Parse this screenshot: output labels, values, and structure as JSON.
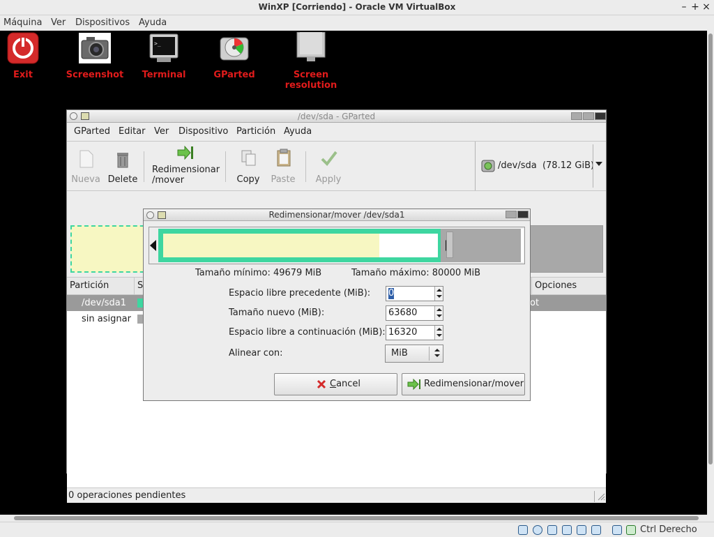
{
  "host": {
    "title": "WinXP [Corriendo] - Oracle VM VirtualBox",
    "controls": [
      "–",
      "+",
      "×"
    ],
    "menu": [
      "Máquina",
      "Ver",
      "Dispositivos",
      "Ayuda"
    ],
    "status_label": "Ctrl Derecho"
  },
  "desktop": {
    "icons": [
      {
        "label": "Exit",
        "icon": "power-icon"
      },
      {
        "label": "Screenshot",
        "icon": "camera-icon"
      },
      {
        "label": "Terminal",
        "icon": "terminal-icon"
      },
      {
        "label": "GParted",
        "icon": "gparted-icon"
      },
      {
        "label": "Screen resolution",
        "icon": "monitor-icon"
      }
    ],
    "label_color": "#e01b1b"
  },
  "gparted": {
    "title": "/dev/sda - GParted",
    "menu": [
      "GParted",
      "Editar",
      "Ver",
      "Dispositivo",
      "Partición",
      "Ayuda"
    ],
    "toolbar": {
      "new": "Nueva",
      "delete": "Delete",
      "resize_line1": "Redimensionar",
      "resize_line2": "/mover",
      "copy": "Copy",
      "paste": "Paste",
      "apply": "Apply"
    },
    "device": {
      "name": "/dev/sda",
      "size": "(78.12 GiB)"
    },
    "columns": {
      "partition": "Partición",
      "s": "S",
      "options": "Opciones"
    },
    "rows": [
      {
        "partition": "/dev/sda1",
        "tail": "ot"
      },
      {
        "partition": "sin asignar"
      }
    ],
    "status": "0 operaciones pendientes",
    "colors": {
      "partition_border": "#3ed6a0",
      "used": "#f7f7c2",
      "unallocated": "#a8a8a8"
    }
  },
  "dialog": {
    "title": "Redimensionar/mover /dev/sda1",
    "min_size": "Tamaño mínimo: 49679 MiB",
    "max_size": "Tamaño máximo: 80000 MiB",
    "fields": {
      "free_before_label": "Espacio libre precedente (MiB):",
      "free_before_value": "0",
      "new_size_label": "Tamaño nuevo (MiB):",
      "new_size_value": "63680",
      "free_after_label": "Espacio libre a continuación (MiB):",
      "free_after_value": "16320",
      "align_label": "Alinear con:",
      "align_value": "MiB"
    },
    "buttons": {
      "cancel_pre": "",
      "cancel_ul": "C",
      "cancel_post": "ancel",
      "resize": "Redimensionar/mover"
    }
  }
}
